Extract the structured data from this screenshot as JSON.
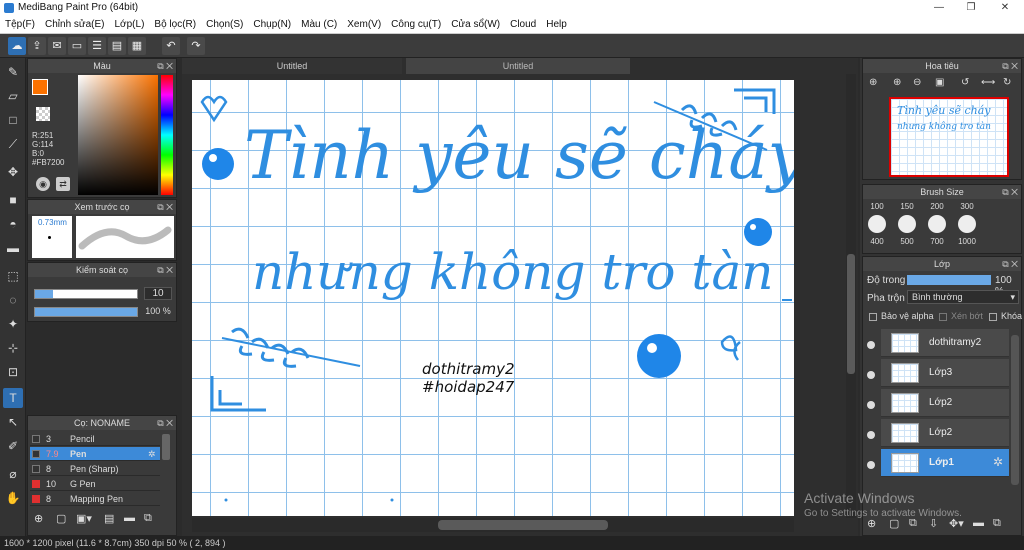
{
  "app": {
    "title": "MediBang Paint Pro (64bit)"
  },
  "menu": [
    "Tệp(F)",
    "Chỉnh sửa(E)",
    "Lớp(L)",
    "Bộ lọc(R)",
    "Chọn(S)",
    "Chụp(N)",
    "Màu (C)",
    "Xem(V)",
    "Công cụ(T)",
    "Cửa sổ(W)",
    "Cloud",
    "Help"
  ],
  "color_panel": {
    "title": "Màu",
    "r": "R:251",
    "g": "G:114",
    "b": "B:0",
    "hex": "#FB7200",
    "fg": "#fb7200"
  },
  "brush_preview": {
    "title": "Xem trước cọ",
    "size": "0.73mm"
  },
  "brush_control": {
    "title": "Kiểm soát cọ",
    "size_value": "10",
    "opacity_value": "100 %"
  },
  "brush_list": {
    "title": "Cọ: NONAME",
    "items": [
      {
        "size": "3",
        "name": "Pencil",
        "color": "#333333",
        "selected": false
      },
      {
        "size": "7.9",
        "name": "Pen",
        "color": "#333333",
        "selected": true
      },
      {
        "size": "8",
        "name": "Pen (Sharp)",
        "color": "#333333",
        "selected": false
      },
      {
        "size": "10",
        "name": "G Pen",
        "color": "#e03030",
        "selected": false
      },
      {
        "size": "8",
        "name": "Mapping Pen",
        "color": "#e03030",
        "selected": false
      }
    ]
  },
  "canvas": {
    "tab1": "Untitled",
    "tab2": "Untitled",
    "line1": "Tình yêu sẽ cháy",
    "line2": "nhưng không tro tàn",
    "sig1": "dothitramy2",
    "sig2": "#hoidap247"
  },
  "navigator": {
    "title": "Hoa tiêu"
  },
  "brush_size": {
    "title": "Brush Size",
    "sizes": [
      "100",
      "150",
      "200",
      "300",
      "400",
      "500",
      "700",
      "1000"
    ]
  },
  "layer_panel": {
    "title": "Lớp",
    "opacity_label": "Độ trong",
    "opacity_value": "100 %",
    "blend_label": "Pha trộn",
    "blend_value": "Bình thường",
    "protect_alpha": "Bảo vệ alpha",
    "clip": "Xén bớt",
    "lock": "Khóa",
    "layers": [
      {
        "name": "dothitramy2"
      },
      {
        "name": "Lớp3"
      },
      {
        "name": "Lớp2"
      },
      {
        "name": "Lớp2"
      },
      {
        "name": "Lớp1"
      }
    ]
  },
  "activate": {
    "line1": "Activate Windows",
    "line2": "Go to Settings to activate Windows."
  },
  "status": {
    "text": "1600 * 1200 pixel    (11.6 * 8.7cm)   350 dpi   50 %   ( 2, 894 )"
  }
}
